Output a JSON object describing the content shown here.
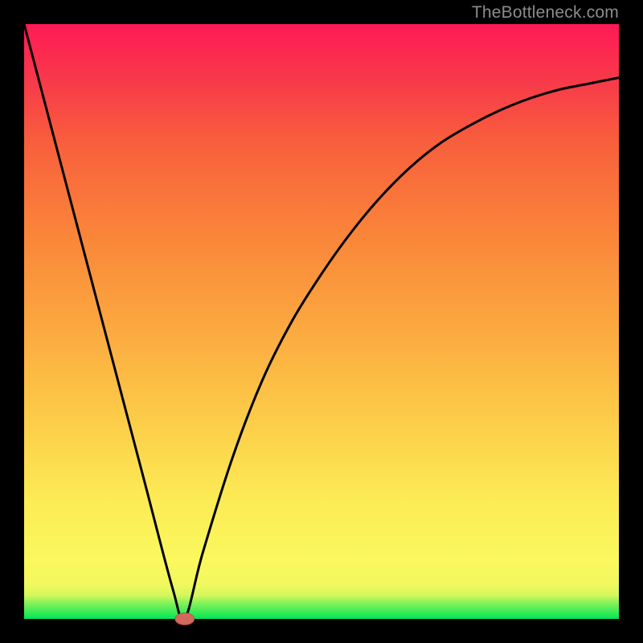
{
  "attribution": "TheBottleneck.com",
  "colors": {
    "frame": "#000000",
    "curve": "#000000",
    "marker_fill": "#d26a5c",
    "marker_stroke": "#b85448"
  },
  "chart_data": {
    "type": "line",
    "title": "",
    "xlabel": "",
    "ylabel": "",
    "xlim": [
      0,
      100
    ],
    "ylim": [
      0,
      100
    ],
    "grid": false,
    "legend": false,
    "series": [
      {
        "name": "bottleneck_curve",
        "x": [
          0,
          5,
          10,
          15,
          20,
          25,
          27,
          30,
          35,
          40,
          45,
          50,
          55,
          60,
          65,
          70,
          75,
          80,
          85,
          90,
          95,
          100
        ],
        "values": [
          100,
          81,
          62,
          43,
          24,
          5,
          0,
          11,
          27,
          40,
          50,
          58,
          65,
          71,
          76,
          80,
          83,
          85.5,
          87.5,
          89,
          90,
          91
        ]
      }
    ],
    "marker": {
      "name": "optimal_point",
      "x": 27,
      "y": 0,
      "rx": 1.6,
      "ry": 1.0
    }
  }
}
